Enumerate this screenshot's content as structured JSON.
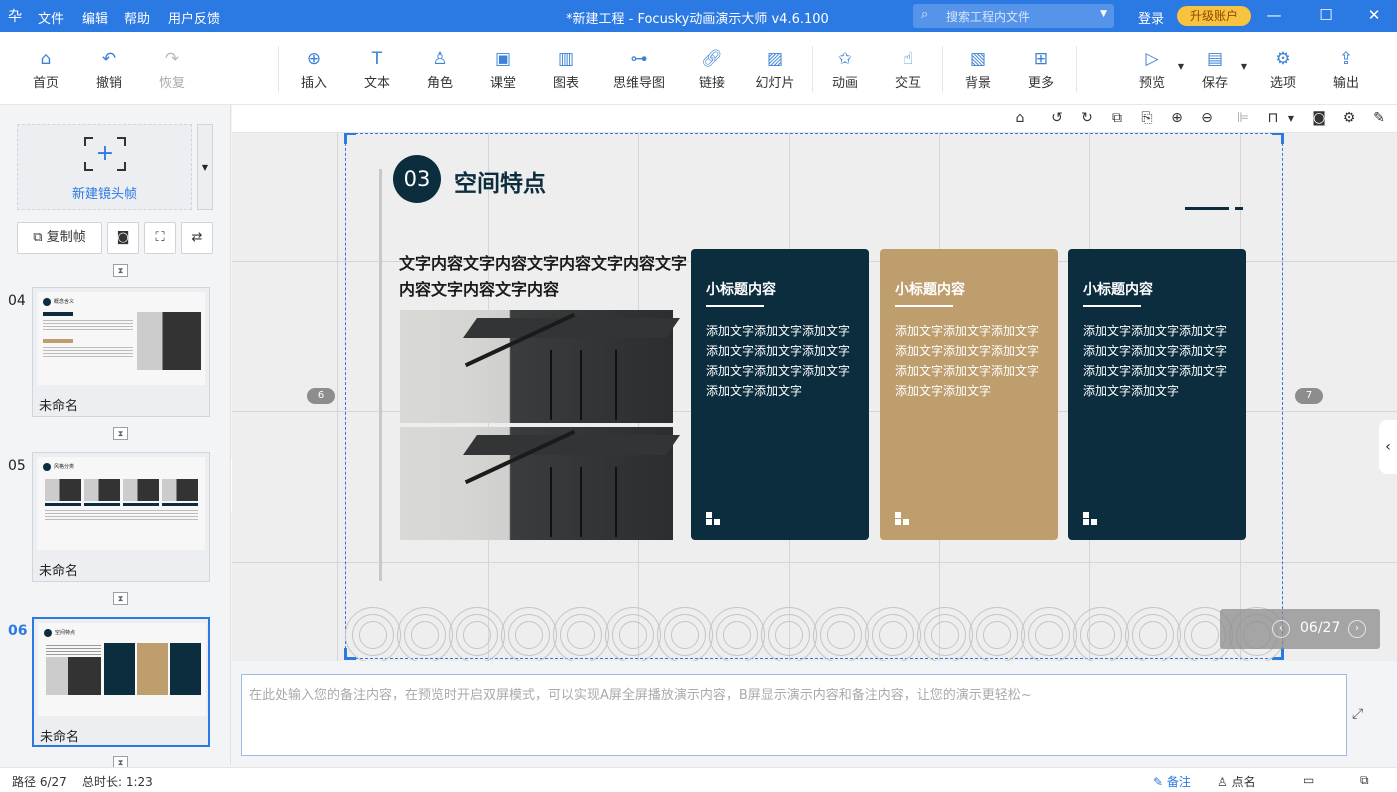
{
  "titlebar": {
    "logo_icon": "app-logo-icon",
    "menu": [
      "文件",
      "编辑",
      "帮助",
      "用户反馈"
    ],
    "title": "*新建工程 - Focusky动画演示大师  v4.6.100",
    "search_placeholder": "搜索工程内文件",
    "login": "登录",
    "upgrade": "升级账户",
    "colors": {
      "bar": "#2b79e3",
      "upgrade": "#f7c341"
    }
  },
  "toolbar": {
    "home": "首页",
    "undo": "撤销",
    "redo": "恢复",
    "insert": "插入",
    "text": "文本",
    "role": "角色",
    "class": "课堂",
    "chart": "图表",
    "mindmap": "思维导图",
    "link": "链接",
    "slideshow": "幻灯片",
    "animation": "动画",
    "interact": "交互",
    "background": "背景",
    "more": "更多",
    "preview": "预览",
    "save": "保存",
    "options": "选项",
    "export": "输出"
  },
  "leftpanel": {
    "new_frame": "新建镜头帧",
    "copy_frame": "复制帧",
    "frames": [
      {
        "num": "04",
        "name": "未命名",
        "thumb_title": "概念含义"
      },
      {
        "num": "05",
        "name": "未命名",
        "thumb_title": "风格分类"
      },
      {
        "num": "06",
        "name": "未命名",
        "thumb_title": "空间特点",
        "selected": true
      }
    ]
  },
  "slide": {
    "section_num": "03",
    "section_title": "空间特点",
    "big_text": "文字内容文字内容文字内容文字内容文字内容文字内容文字内容",
    "cards": [
      {
        "title": "小标题内容",
        "body": "添加文字添加文字添加文字添加文字添加文字添加文字添加文字添加文字添加文字添加文字添加文字",
        "color": "#0c2d3e"
      },
      {
        "title": "小标题内容",
        "body": "添加文字添加文字添加文字添加文字添加文字添加文字添加文字添加文字添加文字添加文字添加文字",
        "color": "#bf9e6e"
      },
      {
        "title": "小标题内容",
        "body": "添加文字添加文字添加文字添加文字添加文字添加文字添加文字添加文字添加文字添加文字添加文字",
        "color": "#0c2d3e"
      }
    ],
    "prev_bubble": "6",
    "next_bubble": "7"
  },
  "page_indicator": "06/27",
  "notes": {
    "placeholder": "在此处输入您的备注内容，在预览时开启双屏模式，可以实现A屏全屏播放演示内容，B屏显示演示内容和备注内容，让您的演示更轻松~"
  },
  "status": {
    "path": "路径 6/27",
    "duration": "总时长: 1:23",
    "notes_btn": "备注",
    "rollcall_btn": "点名"
  }
}
